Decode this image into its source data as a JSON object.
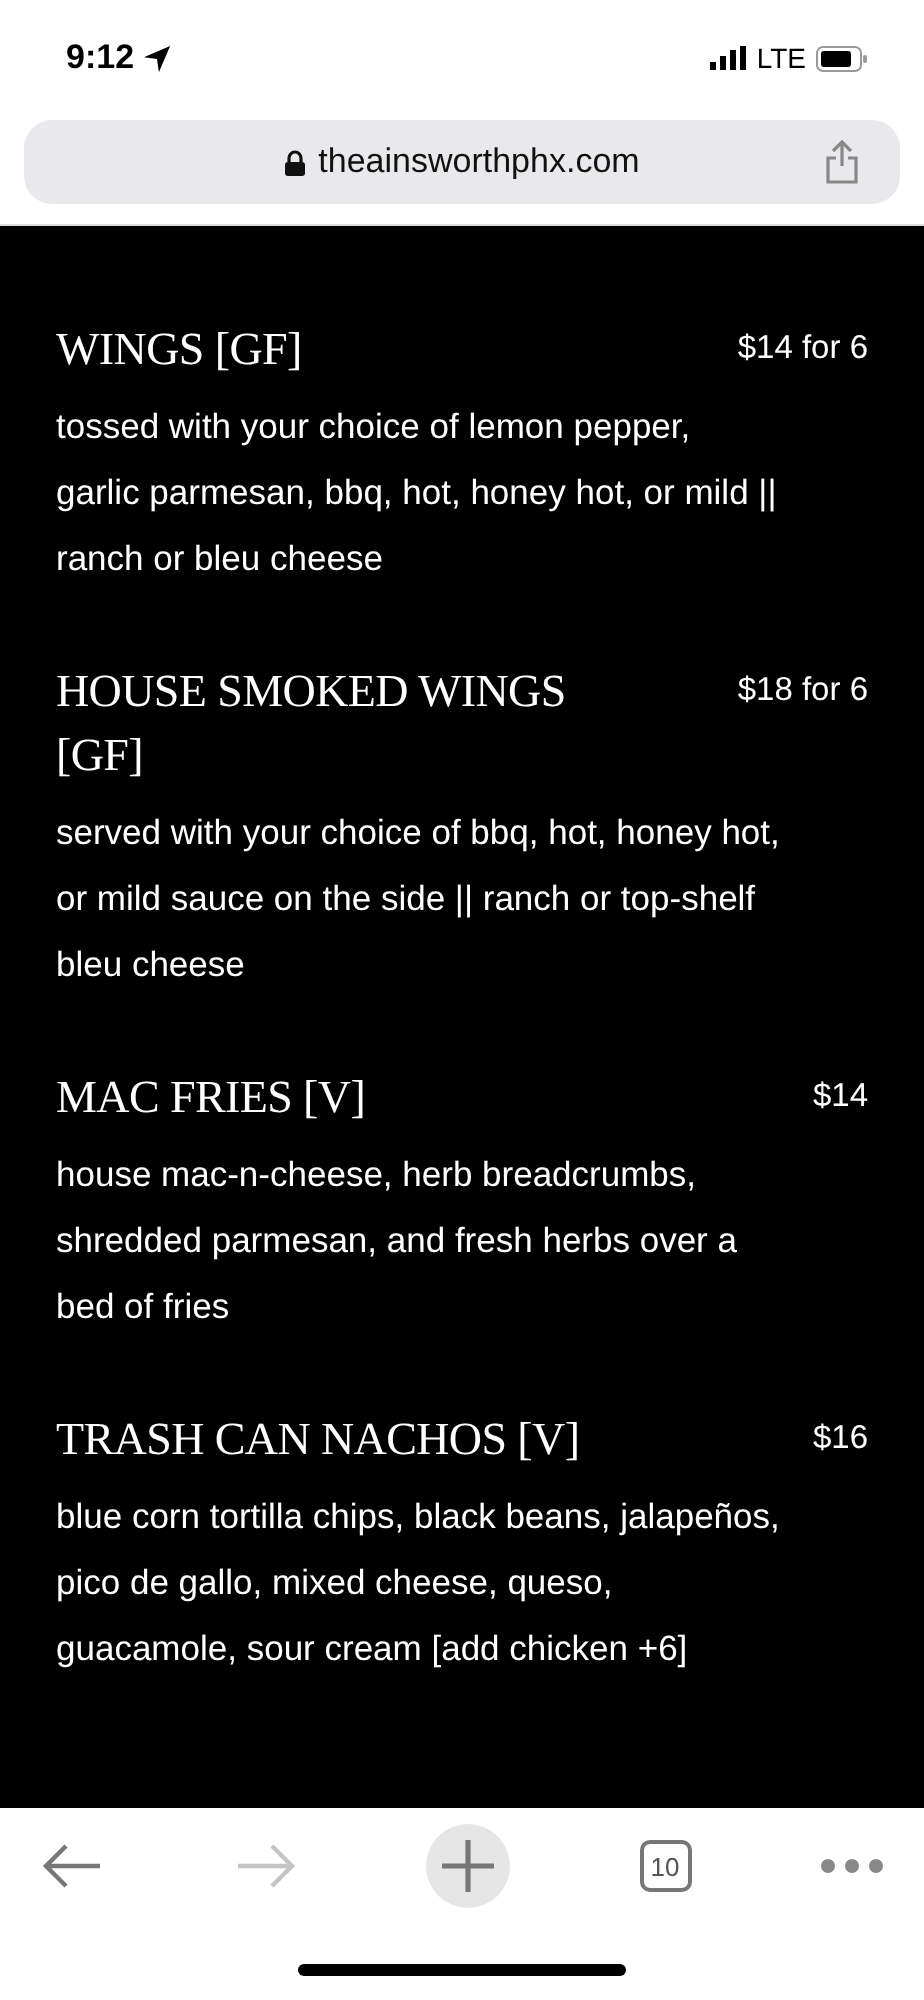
{
  "status_bar": {
    "time": "9:12",
    "network": "LTE"
  },
  "address_bar": {
    "url": "theainsworthphx.com"
  },
  "menu_items": [
    {
      "name": "WINGS [GF]",
      "price": "$14 for 6",
      "description": "tossed with your choice of lemon pepper, garlic parmesan, bbq, hot, honey hot, or mild || ranch or bleu cheese"
    },
    {
      "name": "HOUSE SMOKED WINGS [GF]",
      "price": "$18 for 6",
      "description": "served with your choice of bbq, hot, honey hot, or mild sauce on the side || ranch or top-shelf bleu cheese"
    },
    {
      "name": "MAC FRIES [V]",
      "price": "$14",
      "description": "house mac-n-cheese, herb breadcrumbs, shredded parmesan, and fresh herbs over a bed of fries"
    },
    {
      "name": "TRASH CAN NACHOS [V]",
      "price": "$16",
      "description": "blue corn tortilla chips, black beans, jalapeños, pico de gallo, mixed cheese, queso, guacamole, sour cream [add chicken +6]"
    }
  ],
  "toolbar": {
    "back_disabled": false,
    "forward_disabled": true,
    "tab_count": "10"
  }
}
